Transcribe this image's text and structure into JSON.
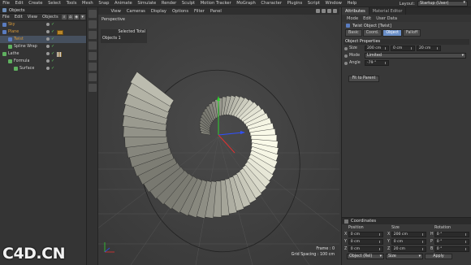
{
  "menubar": [
    "File",
    "Edit",
    "Create",
    "Select",
    "Tools",
    "Mesh",
    "Snap",
    "Animate",
    "Simulate",
    "Render",
    "Sculpt",
    "Motion Tracker",
    "MoGraph",
    "Character",
    "Plugins",
    "Script",
    "Window",
    "Help"
  ],
  "layout": {
    "label": "Layout:",
    "value": "Startup (User)"
  },
  "objects_panel": {
    "title": "Objects",
    "menu": [
      "File",
      "Edit",
      "View",
      "Objects"
    ],
    "tree": [
      {
        "name": "Sky",
        "color": "#d89a3a",
        "indent": 0
      },
      {
        "name": "Plane",
        "color": "#d89a3a",
        "indent": 0
      },
      {
        "name": "Twist",
        "color": "#d89a3a",
        "indent": 1
      },
      {
        "name": "Spline Wrap",
        "color": "#d0d0d0",
        "indent": 1
      },
      {
        "name": "Lathe",
        "color": "#d0d0d0",
        "indent": 0
      },
      {
        "name": "Formula",
        "color": "#d0d0d0",
        "indent": 1
      },
      {
        "name": "Surface",
        "color": "#d0d0d0",
        "indent": 2
      }
    ]
  },
  "viewport": {
    "menu": [
      "View",
      "Cameras",
      "Display",
      "Options",
      "Filter",
      "Panel"
    ],
    "camera": "Perspective",
    "hud_selected": "Selected Total",
    "hud_objects": "Objects  1",
    "frame": "Frame : 0",
    "grid": "Grid Spacing : 100 cm"
  },
  "attributes": {
    "tabs": [
      "Attributes",
      "Material Editor"
    ],
    "menu": [
      "Mode",
      "Edit",
      "User Data"
    ],
    "object_name": "Twist Object [Twist]",
    "param_tabs": [
      "Basic",
      "Coord.",
      "Object",
      "Falloff"
    ],
    "selected_tab": "Object",
    "section": "Object Properties",
    "size_label": "Size",
    "size_values": [
      "200 cm",
      "0 cm",
      "20 cm"
    ],
    "mode_label": "Mode",
    "mode_value": "Limited",
    "angle_label": "Angle",
    "angle_value": "-79 °",
    "fit_button": "Fit to Parent"
  },
  "coordinates": {
    "title": "Coordinates",
    "headers": [
      "Position",
      "Size",
      "Rotation"
    ],
    "rows": [
      {
        "axis": "X",
        "pos": "0 cm",
        "size_axis": "X",
        "size": "200 cm",
        "rot_axis": "H",
        "rot": "0 °"
      },
      {
        "axis": "Y",
        "pos": "0 cm",
        "size_axis": "Y",
        "size": "0 cm",
        "rot_axis": "P",
        "rot": "0 °"
      },
      {
        "axis": "Z",
        "pos": "0 cm",
        "size_axis": "Z",
        "size": "20 cm",
        "rot_axis": "B",
        "rot": "0 °"
      }
    ],
    "mode_dd": "Object (Rel)",
    "size_dd": "Size",
    "apply": "Apply"
  },
  "watermark": "C4D.CN"
}
